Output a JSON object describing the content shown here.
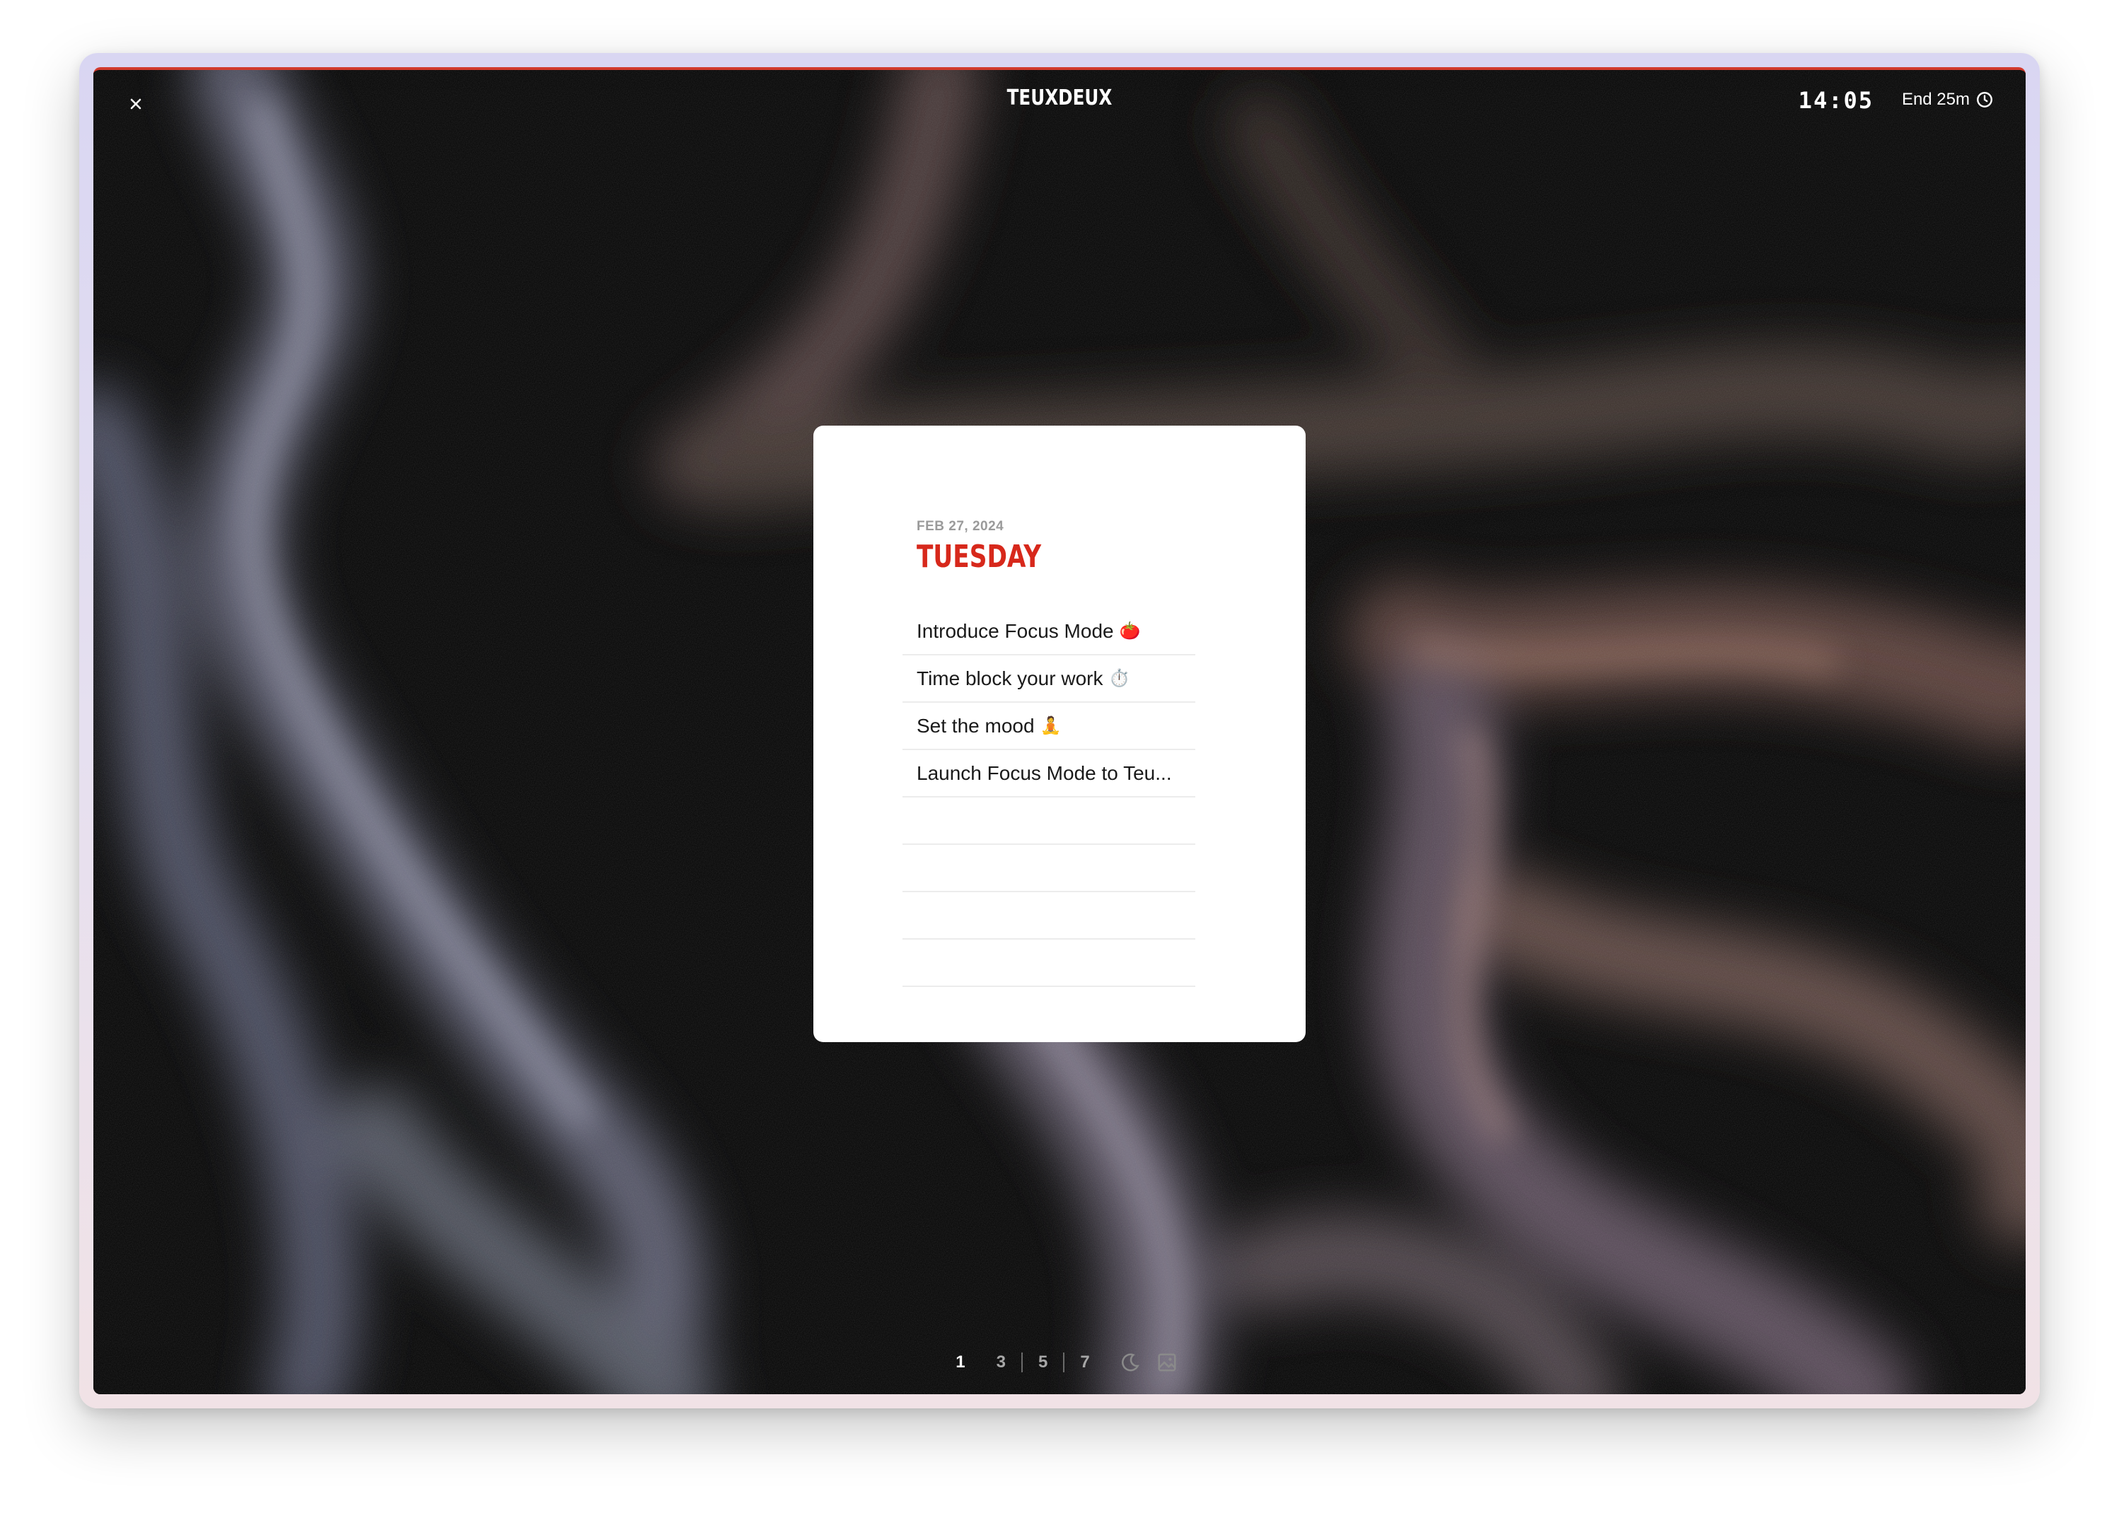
{
  "app": {
    "brand": "TEUXDEUX",
    "clock": "14:05",
    "end_timer": "End 25m",
    "accent_color": "#d7281b"
  },
  "card": {
    "date": "FEB 27, 2024",
    "day": "TUESDAY",
    "todos": [
      {
        "text": "Introduce Focus Mode",
        "emoji": "🍅"
      },
      {
        "text": "Time block your work",
        "emoji": "⏱️"
      },
      {
        "text": "Set the mood",
        "emoji": "🧘"
      },
      {
        "text": "Launch Focus Mode to Teu...",
        "emoji": ""
      },
      {
        "text": "",
        "emoji": ""
      },
      {
        "text": "",
        "emoji": ""
      },
      {
        "text": "",
        "emoji": ""
      },
      {
        "text": "",
        "emoji": ""
      }
    ]
  },
  "controls": {
    "day_counts": [
      "1",
      "3",
      "5",
      "7"
    ],
    "active": "1",
    "icons": [
      "moon-icon",
      "image-icon"
    ]
  }
}
